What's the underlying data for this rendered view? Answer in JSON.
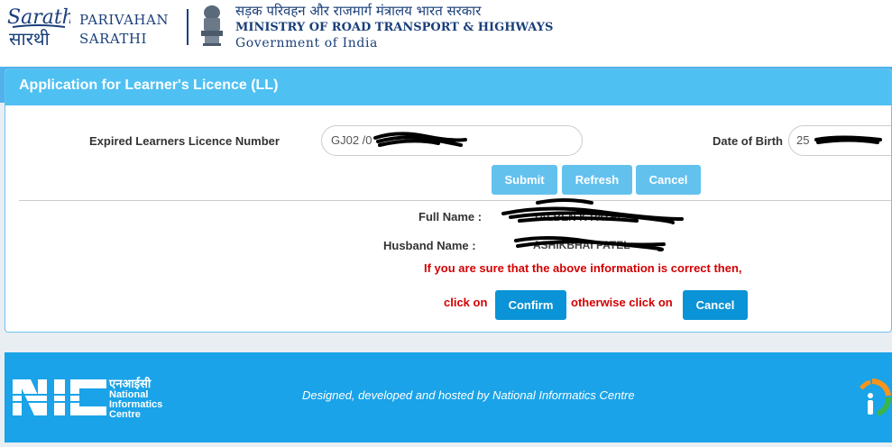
{
  "header": {
    "brand_line1": "PARIVAHAN",
    "brand_line2": "SARATHI",
    "ministry_hindi": "सड़क परिवहन और राजमार्ग मंत्रालय भारत सरकार",
    "ministry_english": "MINISTRY OF ROAD TRANSPORT & HIGHWAYS",
    "government": "Government of India",
    "logo_icon": "sarathi-logo-icon",
    "emblem_icon": "national-emblem-icon"
  },
  "panel": {
    "title": "Application for Learner's Licence (LL)"
  },
  "form": {
    "ll_number_label": "Expired Learners Licence Number",
    "ll_number_value": "GJ02 /0",
    "dob_label": "Date of Birth",
    "dob_value": "25"
  },
  "buttons": {
    "submit": "Submit",
    "refresh": "Refresh",
    "cancel": "Cancel"
  },
  "details": {
    "full_name_label": "Full Name :",
    "full_name_value": "TALBEN K PATEL",
    "husband_name_label": "Husband  Name :",
    "husband_name_value": "ASHIKBHAI PATEL"
  },
  "confirmation": {
    "message": "If you are sure that the above information is correct then,",
    "click_on": "click on",
    "confirm_button": "Confirm",
    "otherwise": "otherwise click on",
    "cancel_button": "Cancel"
  },
  "footer": {
    "nic_hindi": "एनआईसी",
    "nic_line1": "National",
    "nic_line2": "Informatics",
    "nic_line3": "Centre",
    "credit": "Designed, developed and hosted by National Informatics Centre",
    "nic_icon": "nic-logo-icon",
    "digital_india_icon": "digital-india-icon"
  },
  "colors": {
    "panel_header": "#4fc0f2",
    "button_light": "#63c1ee",
    "button_dark": "#0a93d6",
    "warning_red": "#d40000",
    "footer_blue": "#1aa3e8"
  }
}
